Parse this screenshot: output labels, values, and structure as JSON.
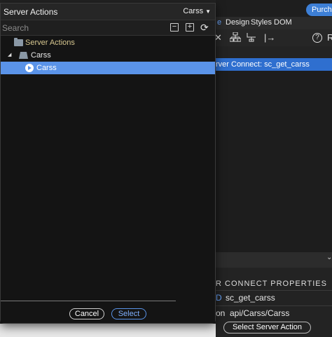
{
  "background": {
    "purchase_label": "Purchas",
    "tabs": [
      {
        "label": "e",
        "active": true
      },
      {
        "label": "Design",
        "active": false
      },
      {
        "label": "Styles",
        "active": false
      },
      {
        "label": "DOM",
        "active": false
      }
    ],
    "toolbar_icons": [
      "close-icon",
      "tree-icon",
      "flow-icon",
      "export-icon"
    ],
    "help_label": "?",
    "selected_row": "rver Connect: sc_get_carss",
    "properties_title": "R CONNECT PROPERTIES",
    "prop_rows": [
      {
        "key": "D",
        "value": "sc_get_carss"
      },
      {
        "key": "on",
        "value": "api/Carss/Carss"
      }
    ],
    "select_action_label": "Select Server Action"
  },
  "dialog": {
    "title": "Server Actions",
    "dropdown_value": "Carss",
    "search_placeholder": "Search",
    "search_value": "",
    "collapse_symbol": "−",
    "expand_symbol": "+",
    "refresh_symbol": "⟳",
    "tree": [
      {
        "label": "Server Actions",
        "level": 0,
        "icon": "folder-icon"
      },
      {
        "label": "Carss",
        "level": 1,
        "icon": "folder-open-icon",
        "expanded": true
      },
      {
        "label": "Carss",
        "level": 2,
        "icon": "play-icon",
        "selected": true
      }
    ],
    "cancel_label": "Cancel",
    "select_label": "Select"
  },
  "colors": {
    "accent": "#5a93e8",
    "purchase": "#3d7fd6",
    "folder_text": "#d6c68f"
  }
}
